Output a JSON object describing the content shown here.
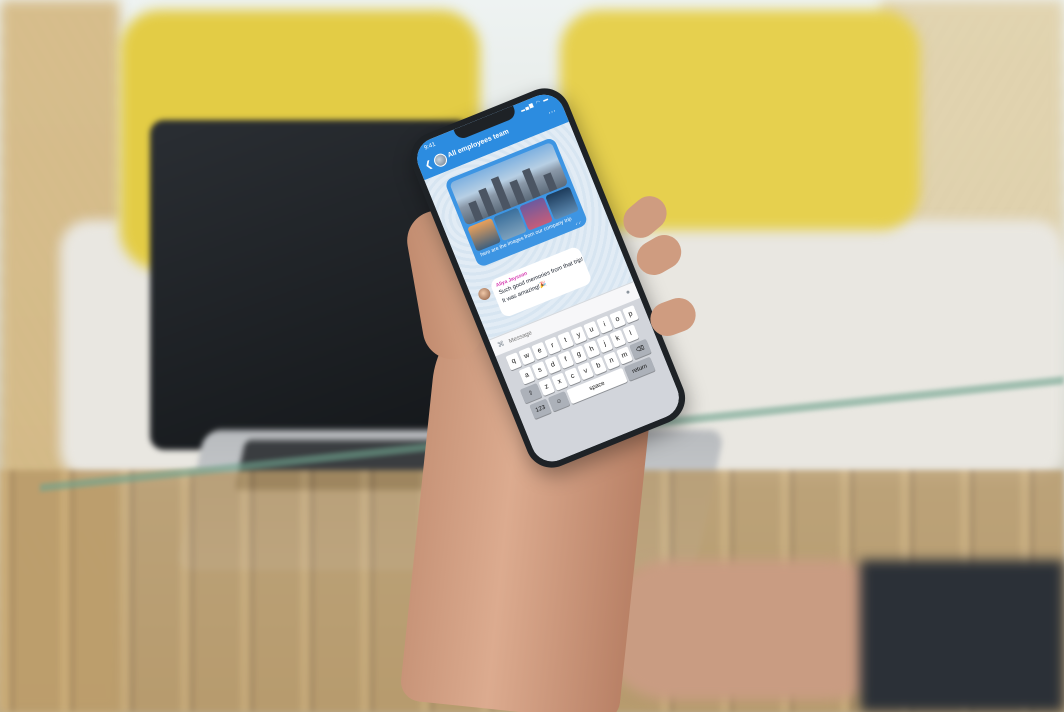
{
  "status": {
    "time": "9:41"
  },
  "chat": {
    "title": "All employees team",
    "outgoing": {
      "caption": "here are the images from our company trip"
    },
    "incoming": {
      "sender": "Aliya Jaysson",
      "lines": [
        "Such good memories from that trip!",
        "It was amazing!🎉"
      ]
    }
  },
  "composer": {
    "placeholder": "Message"
  },
  "keyboard": {
    "row1": [
      "q",
      "w",
      "e",
      "r",
      "t",
      "y",
      "u",
      "i",
      "o",
      "p"
    ],
    "row2": [
      "a",
      "s",
      "d",
      "f",
      "g",
      "h",
      "j",
      "k",
      "l"
    ],
    "row3": [
      "z",
      "x",
      "c",
      "v",
      "b",
      "n",
      "m"
    ],
    "shift": "⇧",
    "backspace": "⌫",
    "numbers": "123",
    "emoji": "☺",
    "space": "space",
    "return": "return"
  },
  "colors": {
    "accent": "#2c8ce0",
    "sender": "#d63ab0"
  }
}
